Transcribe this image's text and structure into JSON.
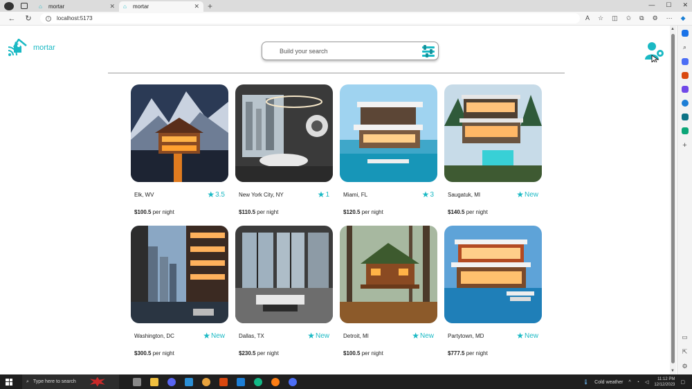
{
  "browser": {
    "tabs": [
      {
        "title": "mortar",
        "active": false
      },
      {
        "title": "mortar",
        "active": true
      }
    ],
    "url": "localhost:5173"
  },
  "header": {
    "logo_text": "mortar",
    "search_placeholder": "Build your search",
    "accent_color": "#1ab9c4"
  },
  "listings": [
    {
      "location": "Elk, WV",
      "rating": "3.5",
      "price": "$100.5",
      "per": "per night",
      "scene": "mountain-chalet"
    },
    {
      "location": "New York City, NY",
      "rating": "1",
      "price": "$110.5",
      "per": "per night",
      "scene": "city-interior"
    },
    {
      "location": "Miami, FL",
      "rating": "3",
      "price": "$120.5",
      "per": "per night",
      "scene": "beach-villa"
    },
    {
      "location": "Saugatuk, MI",
      "rating": "New",
      "price": "$140.5",
      "per": "per night",
      "scene": "lake-house"
    },
    {
      "location": "Washington, DC",
      "rating": "New",
      "price": "$300.5",
      "per": "per night",
      "scene": "city-night"
    },
    {
      "location": "Dallas, TX",
      "rating": "New",
      "price": "$230.5",
      "per": "per night",
      "scene": "loft-interior"
    },
    {
      "location": "Detroit, MI",
      "rating": "New",
      "price": "$100.5",
      "per": "per night",
      "scene": "forest-cabin"
    },
    {
      "location": "Partytown, MD",
      "rating": "New",
      "price": "$777.5",
      "per": "per night",
      "scene": "pool-villa"
    }
  ],
  "taskbar": {
    "search_placeholder": "Type here to search",
    "weather": "Cold weather",
    "time": "11:12 PM",
    "date": "12/12/2023"
  }
}
